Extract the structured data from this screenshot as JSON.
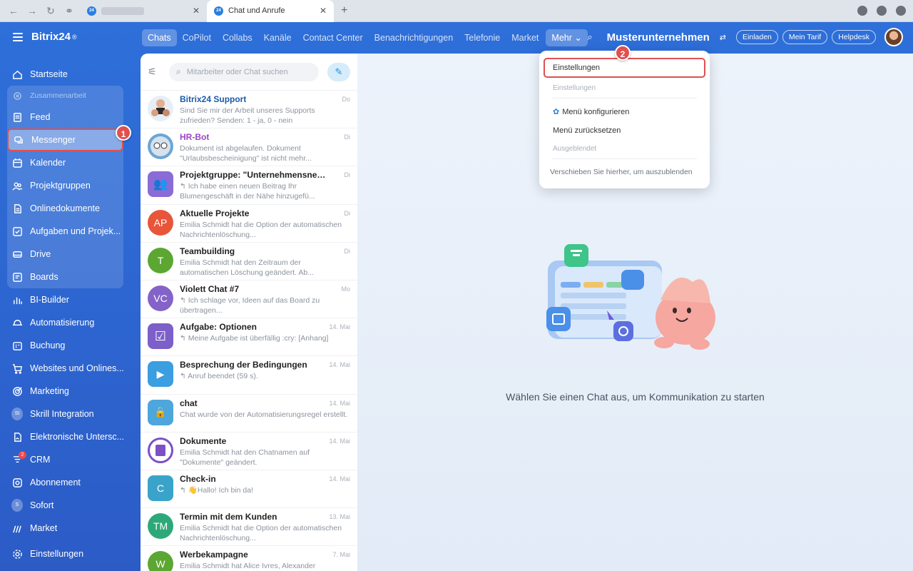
{
  "browser": {
    "tabs": [
      {
        "title": "",
        "active": false
      },
      {
        "title": "Chat und Anrufe",
        "active": true
      }
    ],
    "favicon_text": "24"
  },
  "app": {
    "logo": "Bitrix24",
    "logo_sup": "®"
  },
  "sidebar": {
    "items": [
      {
        "label": "Startseite",
        "icon": "home-icon"
      },
      {
        "label": "Zusammenarbeit",
        "icon": "collab-icon",
        "group_title": true
      },
      {
        "label": "Feed",
        "icon": "feed-icon"
      },
      {
        "label": "Messenger",
        "icon": "messenger-icon",
        "selected": true
      },
      {
        "label": "Kalender",
        "icon": "calendar-icon"
      },
      {
        "label": "Projektgruppen",
        "icon": "groups-icon"
      },
      {
        "label": "Onlinedokumente",
        "icon": "document-icon"
      },
      {
        "label": "Aufgaben und Projek...",
        "icon": "tasks-icon"
      },
      {
        "label": "Drive",
        "icon": "drive-icon"
      },
      {
        "label": "Boards",
        "icon": "boards-icon"
      },
      {
        "label": "BI-Builder",
        "icon": "chart-icon"
      },
      {
        "label": "Automatisierung",
        "icon": "automation-icon"
      },
      {
        "label": "Buchung",
        "icon": "booking-icon"
      },
      {
        "label": "Websites und Onlines...",
        "icon": "cart-icon"
      },
      {
        "label": "Marketing",
        "icon": "target-icon"
      },
      {
        "label": "Skrill Integration",
        "icon": "initial",
        "initial": "SI"
      },
      {
        "label": "Elektronische Untersc...",
        "icon": "signature-icon"
      },
      {
        "label": "CRM",
        "icon": "crm-icon",
        "badge": "2"
      },
      {
        "label": "Abonnement",
        "icon": "subscription-icon"
      },
      {
        "label": "Sofort",
        "icon": "initial",
        "initial": "S"
      },
      {
        "label": "Market",
        "icon": "market-icon"
      },
      {
        "label": "Einstellungen",
        "icon": "gear-icon"
      }
    ],
    "step_badge": "1"
  },
  "topnav": {
    "items": [
      "Chats",
      "CoPilot",
      "Collabs",
      "Kanäle",
      "Contact Center",
      "Benachrichtigungen",
      "Telefonie",
      "Market"
    ],
    "active": "Chats",
    "more_label": "Mehr",
    "company": "Musterunternehmen",
    "buttons": [
      "Einladen",
      "Mein Tarif",
      "Helpdesk"
    ]
  },
  "search": {
    "placeholder": "Mitarbeiter oder Chat suchen"
  },
  "chats": [
    {
      "name": "Bitrix24 Support",
      "date": "Do",
      "msg": "Sind Sie mir der Arbeit unseres Supports zufrieden? Senden: 1 - ja, 0 - nein",
      "style": "blue",
      "avatar": "",
      "color": "#e8eef5",
      "kind": "support"
    },
    {
      "name": "HR-Bot",
      "date": "Di",
      "msg": "Dokument ist abgelaufen. Dokument \"Urlaubsbescheinigung\" ist nicht mehr...",
      "style": "purple",
      "avatar": "",
      "color": "#6aa6d8",
      "kind": "bot"
    },
    {
      "name": "Projektgruppe: \"Unternehmensnews\"",
      "date": "Di",
      "msg": "↰ Ich habe einen neuen Beitrag Ihr Blumengeschäft in der Nähe hinzugefü...",
      "style": "",
      "avatar": "",
      "color": "#8b6bd6",
      "kind": "group"
    },
    {
      "name": "Aktuelle Projekte",
      "date": "Di",
      "msg": "Emilia Schmidt hat die Option der automatischen Nachrichtenlöschung...",
      "style": "",
      "avatar": "AP",
      "color": "#e8553a",
      "kind": "circle"
    },
    {
      "name": "Teambuilding",
      "date": "Di",
      "msg": "Emilia Schmidt hat den Zeitraum der automatischen Löschung geändert. Ab...",
      "style": "",
      "avatar": "T",
      "color": "#5ca632",
      "kind": "circle"
    },
    {
      "name": "Violett Chat #7",
      "date": "Mo",
      "msg": "↰ Ich schlage vor, Ideen auf das Board zu übertragen...",
      "style": "",
      "avatar": "VC",
      "color": "#8463c9",
      "kind": "circle"
    },
    {
      "name": "Aufgabe: Optionen",
      "date": "14. Mai",
      "msg": "↰ Meine Aufgabe ist überfällig :cry: [Anhang]",
      "style": "",
      "avatar": "",
      "color": "#7c5fc9",
      "kind": "task"
    },
    {
      "name": "Besprechung der Bedingungen",
      "date": "14. Mai",
      "msg": "↰ Anruf beendet (59 s).",
      "style": "",
      "avatar": "",
      "color": "#3a9ee0",
      "kind": "video"
    },
    {
      "name": "chat",
      "date": "14. Mai",
      "msg": "Chat wurde von der Automatisierungsregel erstellt.",
      "style": "",
      "avatar": "",
      "color": "#4da6dc",
      "kind": "lock"
    },
    {
      "name": "Dokumente",
      "date": "14. Mai",
      "msg": "Emilia Schmidt hat den Chatnamen auf \"Dokumente\" geändert.",
      "style": "",
      "avatar": "",
      "color": "#7e4fc7",
      "kind": "doc"
    },
    {
      "name": "Check-in",
      "date": "14. Mai",
      "msg": "↰ 👋Hallo! Ich bin da!",
      "style": "",
      "avatar": "C",
      "color": "#3aa3c9",
      "kind": "square"
    },
    {
      "name": "Termin mit dem Kunden",
      "date": "13. Mai",
      "msg": "Emilia Schmidt hat die Option der automatischen Nachrichtenlöschung...",
      "style": "",
      "avatar": "TM",
      "color": "#2fa879",
      "kind": "circle"
    },
    {
      "name": "Werbekampagne",
      "date": "7. Mai",
      "msg": "Emilia Schmidt hat Alice Ivres, Alexander",
      "style": "",
      "avatar": "W",
      "color": "#5ca632",
      "kind": "circle"
    }
  ],
  "content": {
    "empty_text": "Wählen Sie einen Chat aus, um Kommunikation zu starten"
  },
  "dropdown": {
    "settings": "Einstellungen",
    "section_settings": "Einstellungen",
    "configure": "Menü konfigurieren",
    "reset": "Menü zurücksetzen",
    "section_hidden": "Ausgeblendet",
    "hint": "Verschieben Sie hierher, um auszublenden",
    "step_badge": "2"
  }
}
